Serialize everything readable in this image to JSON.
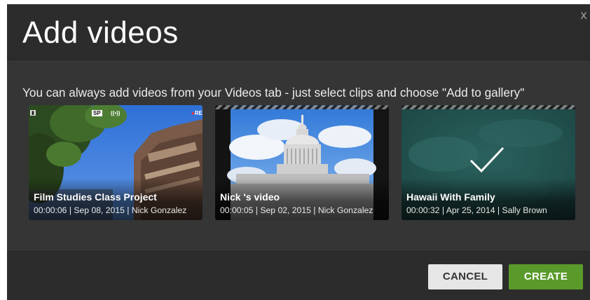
{
  "dialog": {
    "title": "Add videos",
    "close_label": "x",
    "subtitle": "You can always add videos from your Videos tab - just select clips and choose \"Add to gallery\""
  },
  "videos": [
    {
      "title": "Film Studies Class Project",
      "meta": "00:00:06 | Sep 08, 2015 | Nick Gonzalez",
      "selected": false,
      "overlay": {
        "sp": "SP",
        "rec": "RE"
      }
    },
    {
      "title": "Nick 's video",
      "meta": "00:00:05 | Sep 02, 2015 | Nick Gonzalez",
      "selected": false
    },
    {
      "title": "Hawaii With Family",
      "meta": "00:00:32 | Apr 25, 2014 | Sally Brown",
      "selected": true
    }
  ],
  "footer": {
    "cancel_label": "CANCEL",
    "create_label": "CREATE"
  },
  "colors": {
    "create_button": "#5a9a2b",
    "cancel_button": "#e6e6e6",
    "dialog_bg": "#333333"
  },
  "icons": {
    "close": "close-icon",
    "selected": "checkmark-icon"
  }
}
